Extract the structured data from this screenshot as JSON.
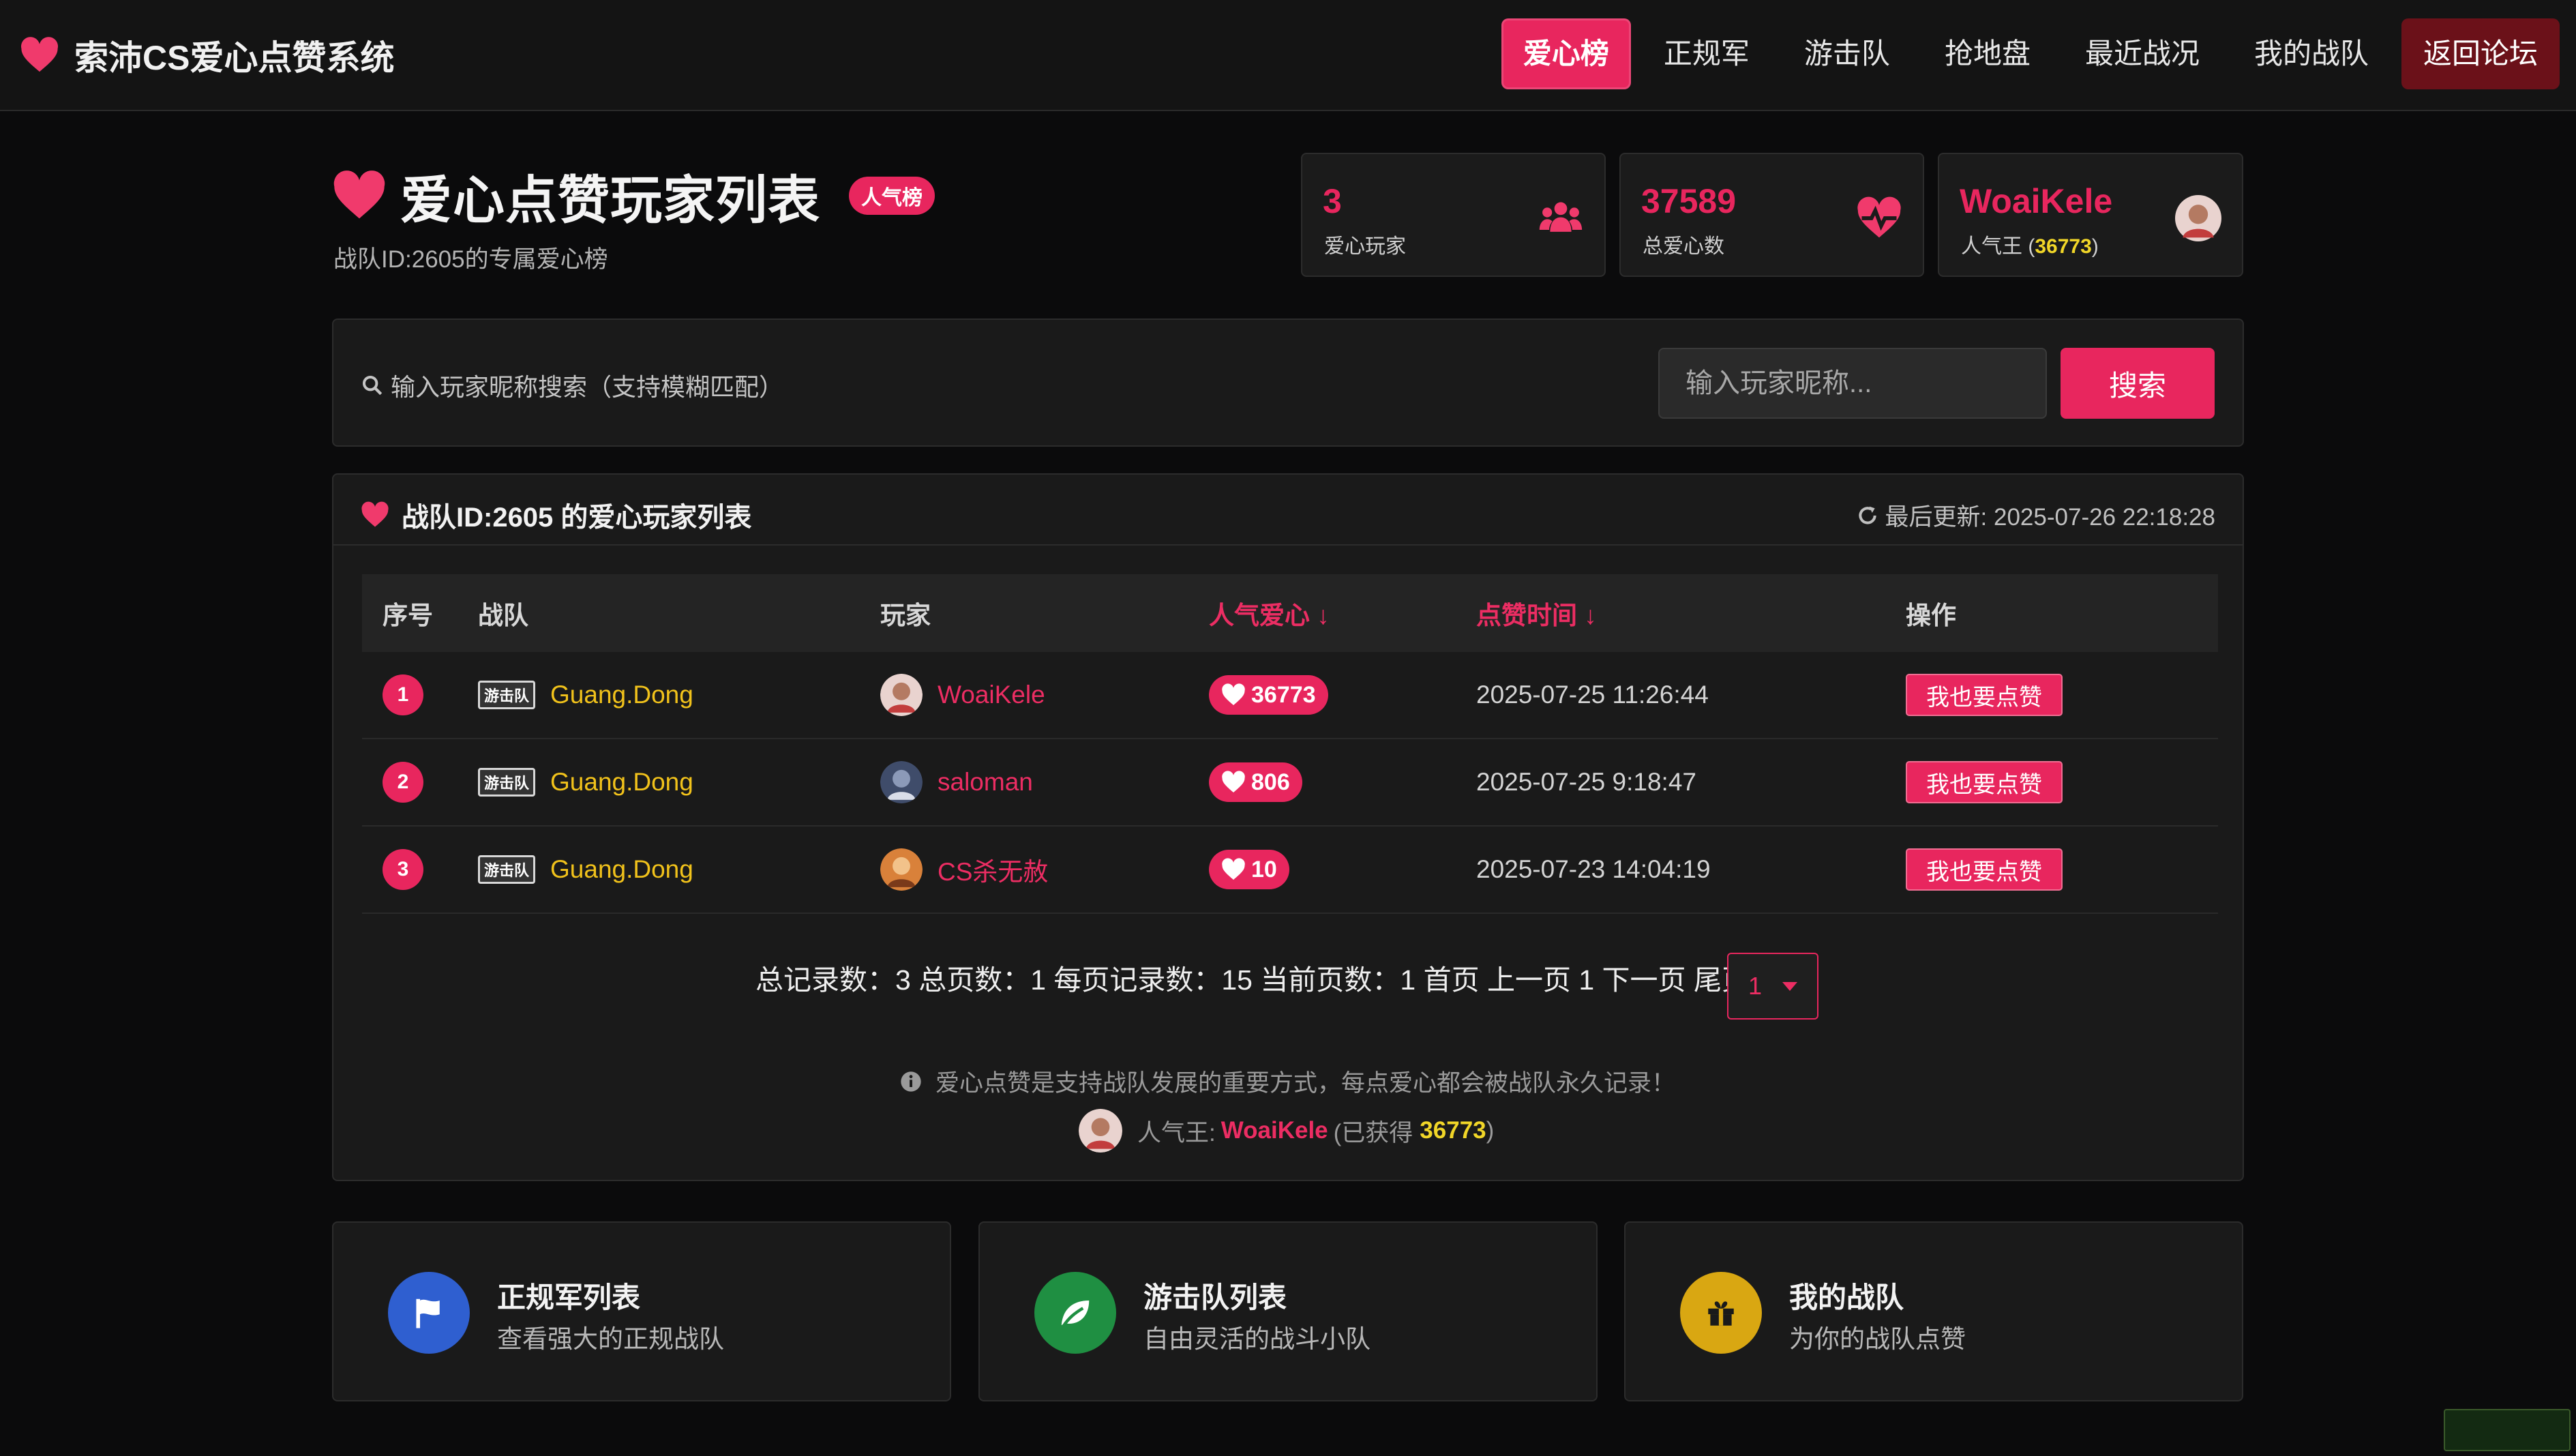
{
  "brand": {
    "name": "索沛CS爱心点赞系统"
  },
  "nav": {
    "items": [
      "爱心榜",
      "正规军",
      "游击队",
      "抢地盘",
      "最近战况",
      "我的战队",
      "返回论坛"
    ],
    "active": "爱心榜"
  },
  "header": {
    "title": "爱心点赞玩家列表",
    "badge": "人气榜",
    "subtitle": "战队ID:2605的专属爱心榜"
  },
  "stats": [
    {
      "value": "3",
      "label": "爱心玩家",
      "icon": "users-icon"
    },
    {
      "value": "37589",
      "label": "总爱心数",
      "icon": "heart-pulse-icon"
    },
    {
      "value": "WoaiKele",
      "label_prefix": "人气王 (",
      "label_value": "36773",
      "label_suffix": ")",
      "icon": "avatar"
    }
  ],
  "search": {
    "label": "输入玩家昵称搜索（支持模糊匹配）",
    "placeholder": "输入玩家昵称...",
    "button": "搜索"
  },
  "list": {
    "title": "战队ID:2605 的爱心玩家列表",
    "updated": "最后更新: 2025-07-26 22:18:28",
    "columns": [
      "序号",
      "战队",
      "玩家",
      "人气爱心 ↓",
      "点赞时间 ↓",
      "操作"
    ],
    "rows": [
      {
        "rank": "1",
        "team_tag": "游击队",
        "team": "Guang.Dong",
        "player": "WoaiKele",
        "likes": "36773",
        "time": "2025-07-25 11:26:44",
        "action": "我也要点赞"
      },
      {
        "rank": "2",
        "team_tag": "游击队",
        "team": "Guang.Dong",
        "player": "saloman",
        "likes": "806",
        "time": "2025-07-25 9:18:47",
        "action": "我也要点赞"
      },
      {
        "rank": "3",
        "team_tag": "游击队",
        "team": "Guang.Dong",
        "player": "CS杀无赦",
        "likes": "10",
        "time": "2025-07-23 14:04:19",
        "action": "我也要点赞"
      }
    ],
    "pager_text": "总记录数：3 总页数：1 每页记录数：15 当前页数：1 首页 上一页 1 下一页 尾页",
    "pager_select": "1",
    "note": "爱心点赞是支持战队发展的重要方式，每点爱心都会被战队永久记录！",
    "king_prefix": "人气王:",
    "king_name": "WoaiKele",
    "king_mid": "(已获得",
    "king_value": "36773",
    "king_suffix": ")"
  },
  "cards": [
    {
      "title": "正规军列表",
      "subtitle": "查看强大的正规战队",
      "icon": "flag-icon",
      "color": "#2f5fd0"
    },
    {
      "title": "游击队列表",
      "subtitle": "自由灵活的战斗小队",
      "icon": "leaf-icon",
      "color": "#1f8f42"
    },
    {
      "title": "我的战队",
      "subtitle": "为你的战队点赞",
      "icon": "gift-icon",
      "color": "#d9a712"
    }
  ],
  "colors": {
    "accent": "#e8265e",
    "team": "#f1c21b",
    "highlight": "#f1d628"
  }
}
